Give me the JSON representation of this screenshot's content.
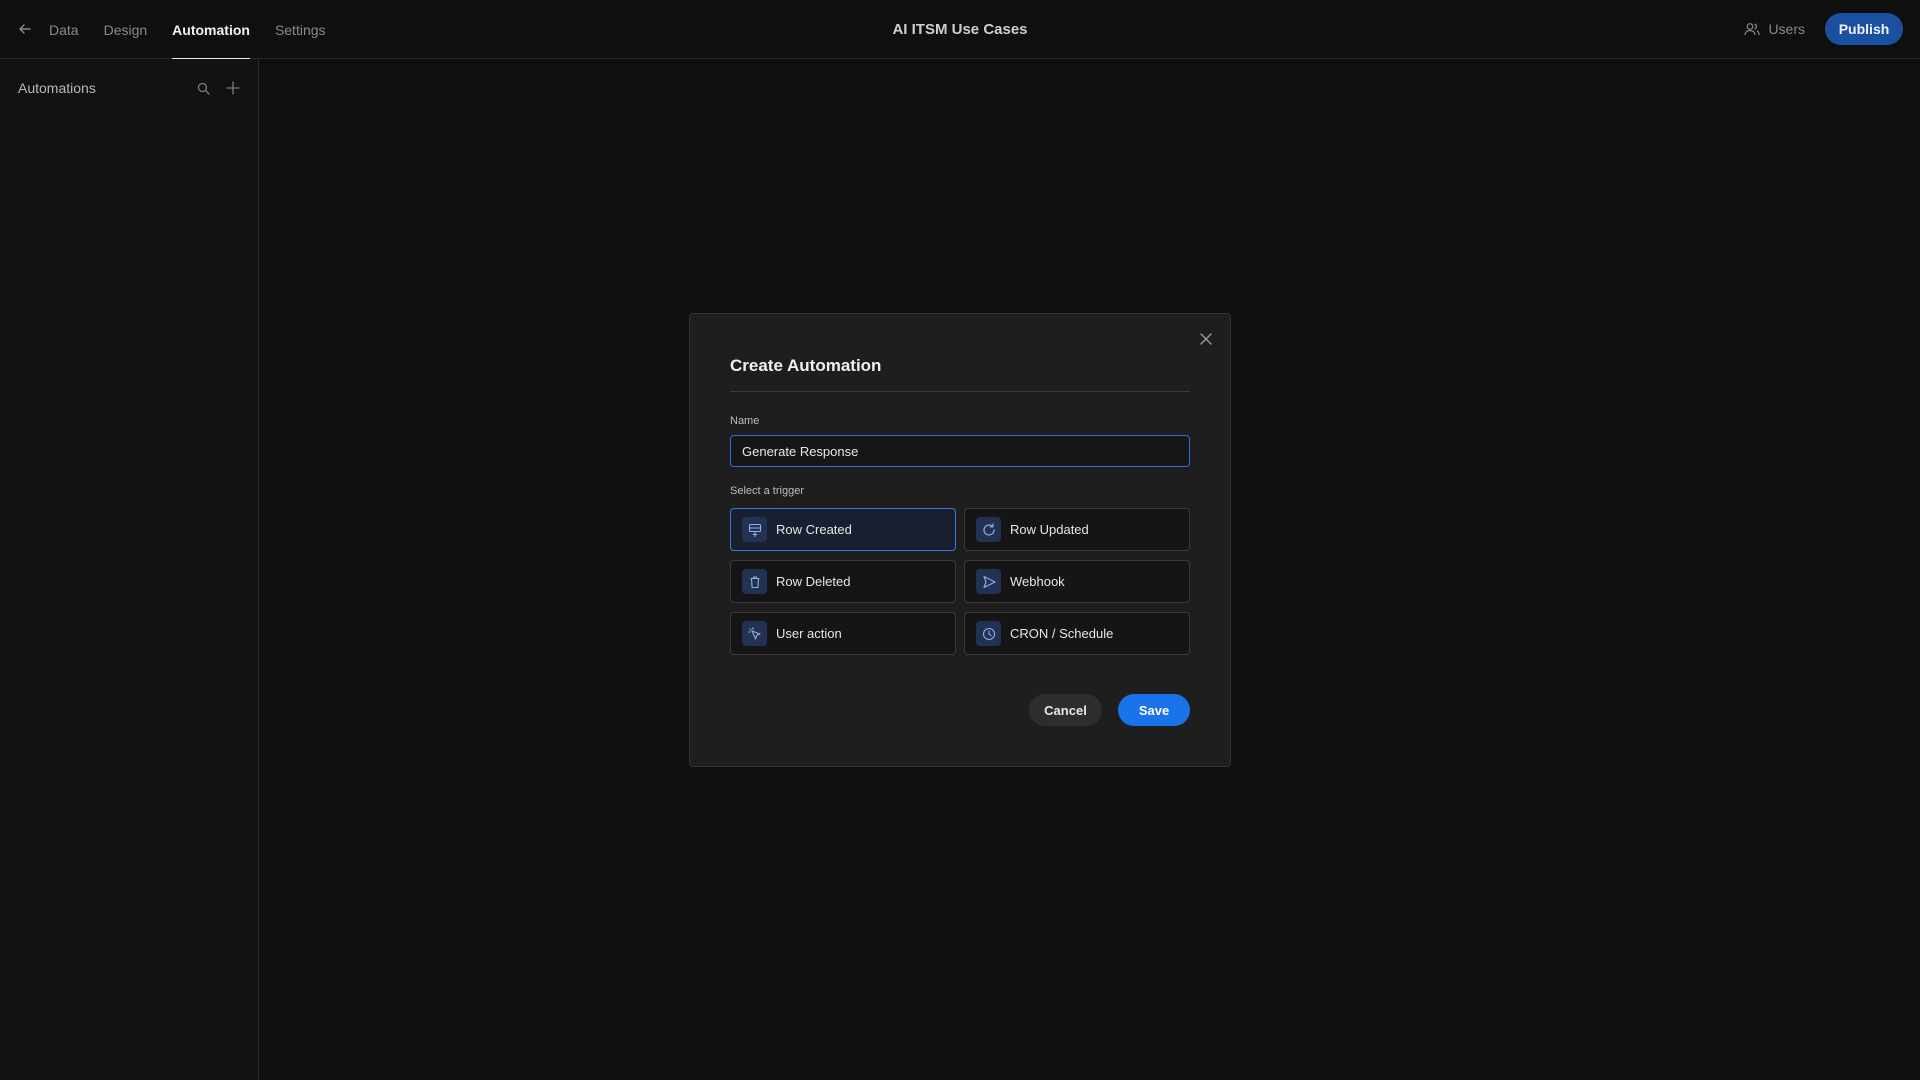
{
  "header": {
    "back_icon": "arrow-left-icon",
    "tabs": [
      {
        "label": "Data",
        "active": false
      },
      {
        "label": "Design",
        "active": false
      },
      {
        "label": "Automation",
        "active": true
      },
      {
        "label": "Settings",
        "active": false
      }
    ],
    "title": "AI ITSM Use Cases",
    "users_label": "Users",
    "publish_label": "Publish"
  },
  "sidebar": {
    "title": "Automations",
    "icons": [
      "search-icon",
      "plus-icon"
    ]
  },
  "modal": {
    "title": "Create Automation",
    "name_label": "Name",
    "name_value": "Generate Response",
    "trigger_label": "Select a trigger",
    "triggers": [
      {
        "label": "Row Created",
        "icon": "row-created-icon",
        "selected": true
      },
      {
        "label": "Row Updated",
        "icon": "refresh-icon",
        "selected": false
      },
      {
        "label": "Row Deleted",
        "icon": "trash-icon",
        "selected": false
      },
      {
        "label": "Webhook",
        "icon": "send-icon",
        "selected": false
      },
      {
        "label": "User action",
        "icon": "cursor-click-icon",
        "selected": false
      },
      {
        "label": "CRON / Schedule",
        "icon": "clock-icon",
        "selected": false
      }
    ],
    "cancel_label": "Cancel",
    "save_label": "Save"
  },
  "colors": {
    "background": "#0f0f0f",
    "accent": "#1a73e8",
    "publish": "#1b4fa0",
    "selected_border": "#3b78d8"
  }
}
